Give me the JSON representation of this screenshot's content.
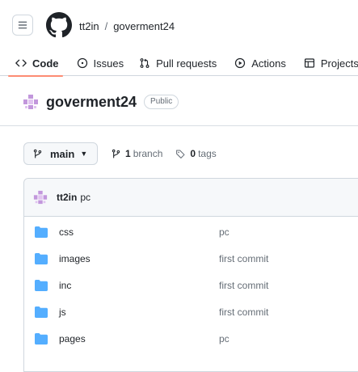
{
  "header": {
    "owner": "tt2in",
    "separator": "/",
    "repo": "goverment24"
  },
  "tabs": [
    {
      "label": "Code",
      "icon": "code-icon",
      "active": true
    },
    {
      "label": "Issues",
      "icon": "issue-opened-icon"
    },
    {
      "label": "Pull requests",
      "icon": "git-pull-request-icon"
    },
    {
      "label": "Actions",
      "icon": "play-icon"
    },
    {
      "label": "Projects",
      "icon": "table-icon"
    }
  ],
  "repo_title": {
    "name": "goverment24",
    "visibility": "Public"
  },
  "branch": {
    "name": "main",
    "branches_count": "1",
    "branches_label": "branch",
    "tags_count": "0",
    "tags_label": "tags"
  },
  "latest_commit": {
    "author": "tt2in",
    "message": "pc"
  },
  "files": [
    {
      "name": "css",
      "commit": "pc"
    },
    {
      "name": "images",
      "commit": "first commit"
    },
    {
      "name": "inc",
      "commit": "first commit"
    },
    {
      "name": "js",
      "commit": "first commit"
    },
    {
      "name": "pages",
      "commit": "pc"
    }
  ],
  "colors": {
    "accent_underline": "#fd8c73",
    "folder": "#54aeff",
    "avatar": "#c297dc"
  }
}
